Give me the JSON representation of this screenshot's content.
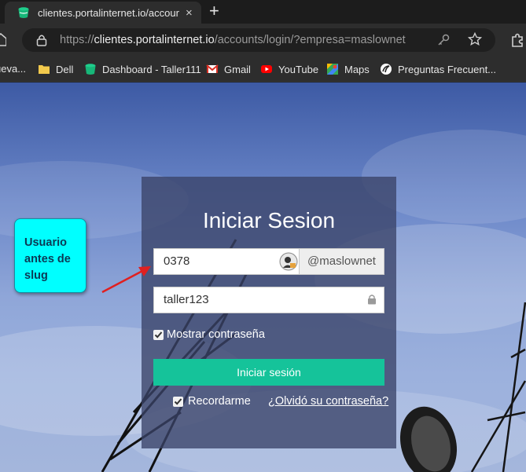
{
  "browser": {
    "tab_title": "clientes.portalinternet.io/accounts",
    "tab_close": "×",
    "new_tab": "+",
    "url_prefix": "https://",
    "url_host": "clientes.portalinternet.io",
    "url_path": "/accounts/login/?empresa=maslownet",
    "bookmarks": [
      {
        "label": "ueva...",
        "icon": "folder-icon"
      },
      {
        "label": "Dell",
        "icon": "folder-icon"
      },
      {
        "label": "Dashboard - Taller111",
        "icon": "bucket-icon"
      },
      {
        "label": "Gmail",
        "icon": "gmail-icon"
      },
      {
        "label": "YouTube",
        "icon": "youtube-icon"
      },
      {
        "label": "Maps",
        "icon": "maps-icon"
      },
      {
        "label": "Preguntas Frecuent...",
        "icon": "help-icon"
      }
    ]
  },
  "login": {
    "title": "Iniciar Sesion",
    "username_value": "0378",
    "slug_addon": "@maslownet",
    "password_value": "taller123",
    "show_password_label": "Mostrar contraseña",
    "show_password_checked": true,
    "submit_label": "Iniciar sesión",
    "remember_label": "Recordarme",
    "remember_checked": true,
    "forgot_label": "¿Olvidó su contraseña?"
  },
  "annotation": {
    "callout_text": "Usuario antes de slug",
    "arrow_color": "#e02020"
  },
  "colors": {
    "accent_button": "#15c39a",
    "callout_bg": "#00ffff"
  }
}
